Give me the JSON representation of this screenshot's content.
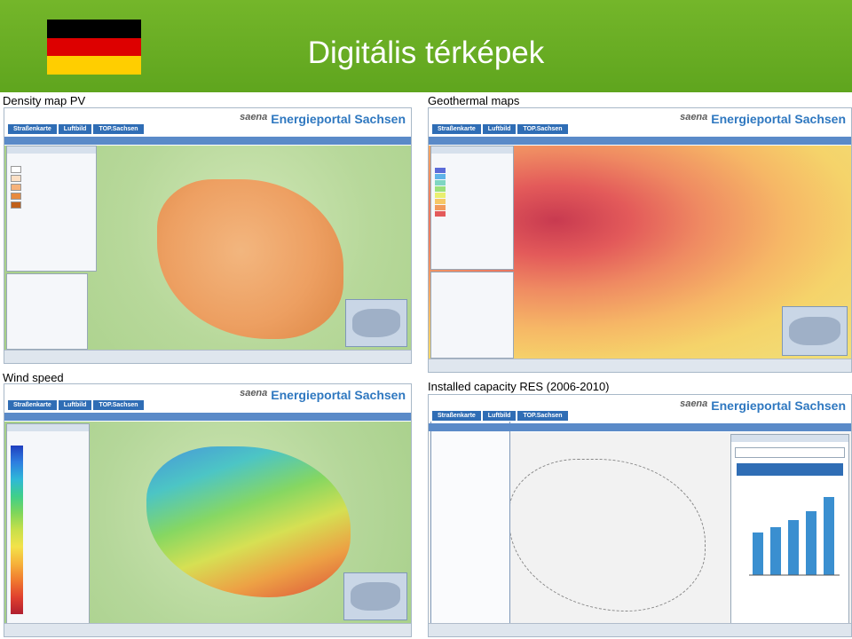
{
  "title": "Digitális térképek",
  "flag_colors": [
    "#000000",
    "#dd0000",
    "#ffce00"
  ],
  "panels": {
    "p1": {
      "label": "Density map PV"
    },
    "p2": {
      "label": "Geothermal maps"
    },
    "p3": {
      "label": "Wind speed"
    },
    "p4": {
      "label": "Installed capacity RES (2006-2010)"
    }
  },
  "app": {
    "saena": "saena",
    "portal": "Energieportal Sachsen",
    "tabs": [
      "Straßenkarte",
      "Luftbild",
      "TOP.Sachsen"
    ]
  },
  "colors": {
    "header_green": "#6aad23",
    "tab_blue": "#2f6db5",
    "brand_blue": "#2f78c0"
  }
}
